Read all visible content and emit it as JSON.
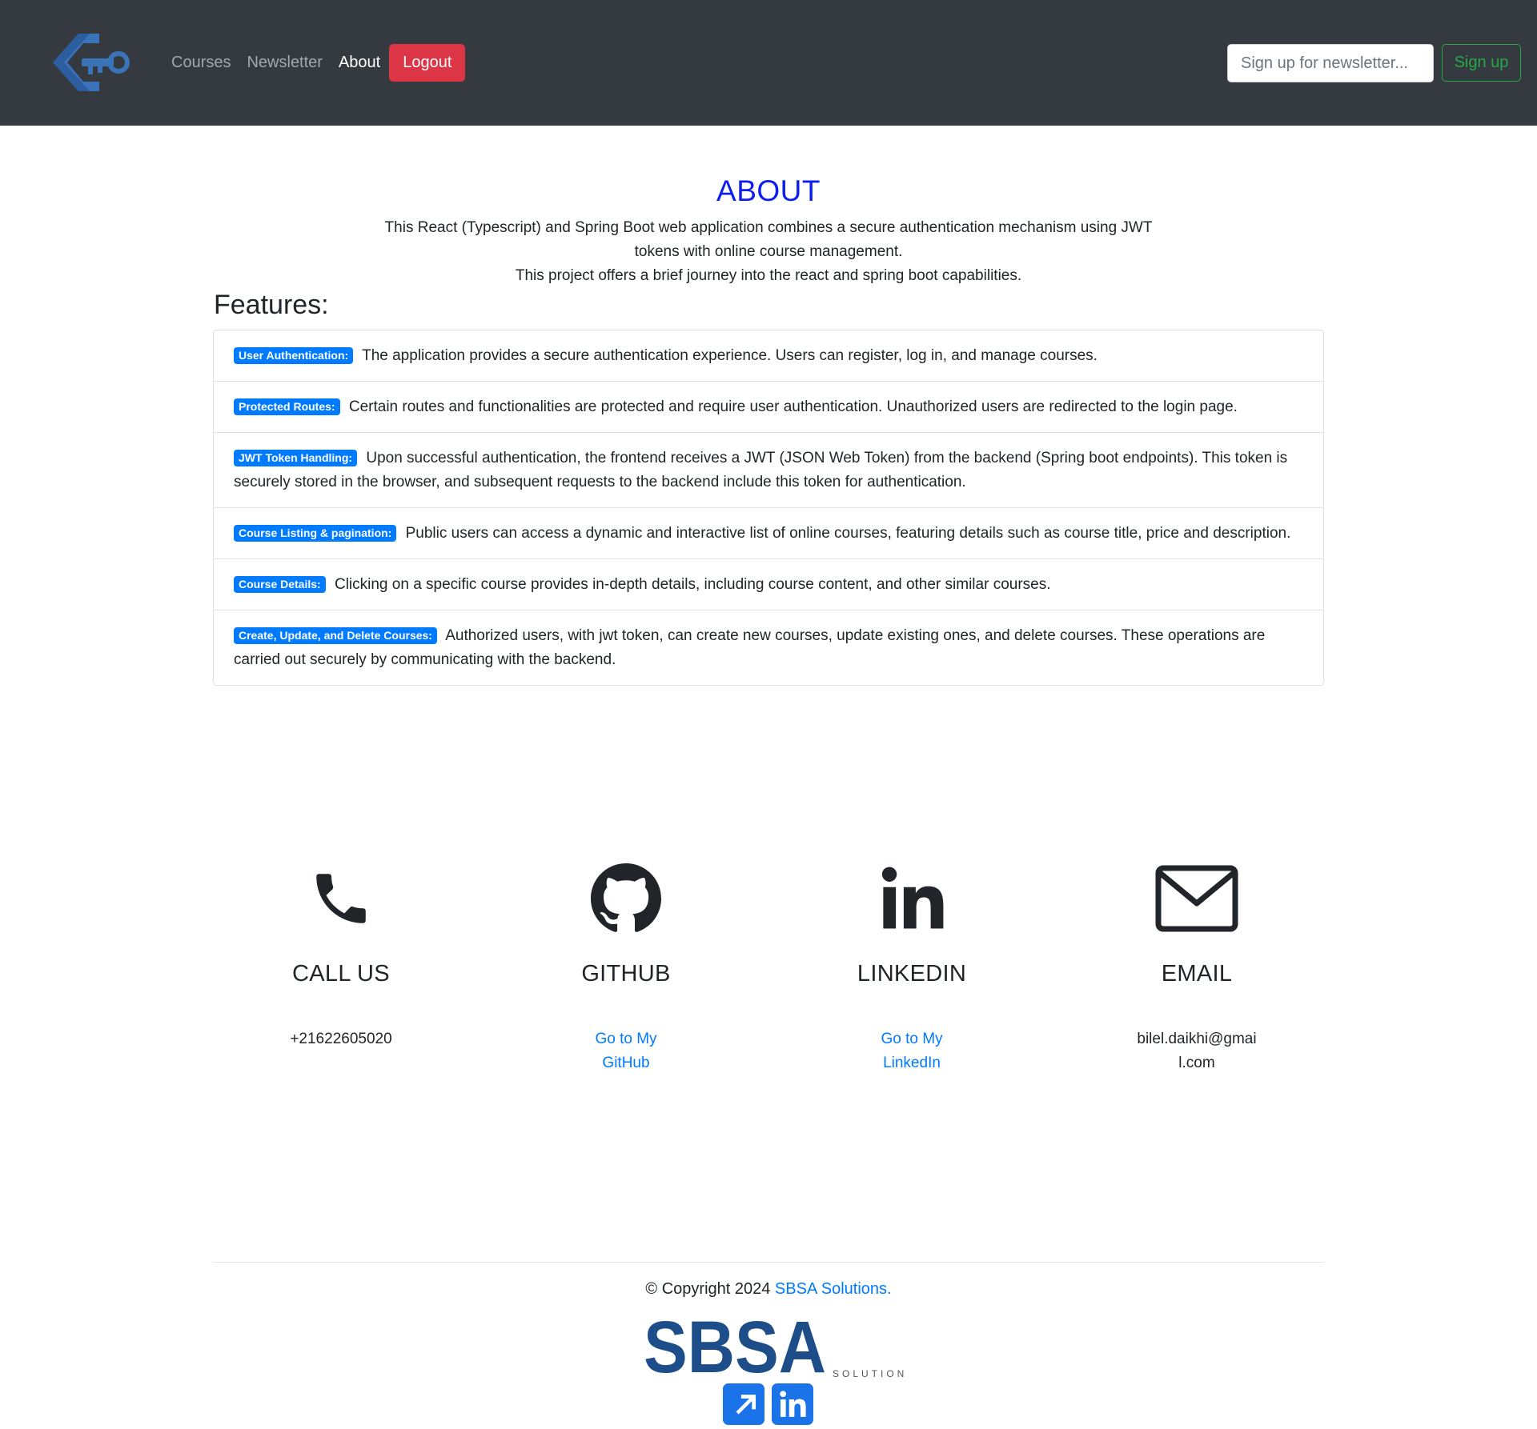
{
  "navbar": {
    "links": [
      {
        "label": "Courses",
        "active": false
      },
      {
        "label": "Newsletter",
        "active": false
      },
      {
        "label": "About",
        "active": true
      }
    ],
    "logout_label": "Logout",
    "newsletter_placeholder": "Sign up for newsletter...",
    "signup_label": "Sign up"
  },
  "about": {
    "title": "ABOUT",
    "line1": "This React (Typescript) and Spring Boot web application combines a secure authentication mechanism using JWT tokens with online course management.",
    "line2": "This project offers a brief journey into the react and spring boot capabilities."
  },
  "features": {
    "title": "Features:",
    "items": [
      {
        "badge": "User Authentication:",
        "text": "The application provides a secure authentication experience. Users can register, log in, and manage courses."
      },
      {
        "badge": "Protected Routes:",
        "text": "Certain routes and functionalities are protected and require user authentication. Unauthorized users are redirected to the login page."
      },
      {
        "badge": "JWT Token Handling:",
        "text": "Upon successful authentication, the frontend receives a JWT (JSON Web Token) from the backend (Spring boot endpoints). This token is securely stored in the browser, and subsequent requests to the backend include this token for authentication."
      },
      {
        "badge": "Course Listing & pagination:",
        "text": "Public users can access a dynamic and interactive list of online courses, featuring details such as course title, price and description."
      },
      {
        "badge": "Course Details:",
        "text": "Clicking on a specific course provides in-depth details, including course content, and other similar courses."
      },
      {
        "badge": "Create, Update, and Delete Courses:",
        "text": "Authorized users, with jwt token, can create new courses, update existing ones, and delete courses. These operations are carried out securely by communicating with the backend."
      }
    ]
  },
  "contact": {
    "call": {
      "title": "CALL US",
      "value": "+21622605020",
      "icon": "phone-icon"
    },
    "github": {
      "title": "GITHUB",
      "link": "Go to My GitHub",
      "icon": "github-icon"
    },
    "linkedin": {
      "title": "LINKEDIN",
      "link": "Go to My LinkedIn",
      "icon": "linkedin-icon"
    },
    "email": {
      "title": "EMAIL",
      "value": "bilel.daikhi@gmail.com",
      "icon": "envelope-icon"
    }
  },
  "footer": {
    "copyright_prefix": "© Copyright 2024",
    "company_link": "SBSA Solutions.",
    "logo_text": "SBSA",
    "logo_subtext": "SOLUTIONS"
  },
  "colors": {
    "navbar_bg": "#343a40",
    "about_title": "#0d1ef0",
    "badge": "#007bff",
    "logout": "#dc3545",
    "signup": "#28a745",
    "link": "#007bff",
    "sbsa_brand": "#1d4e89"
  }
}
